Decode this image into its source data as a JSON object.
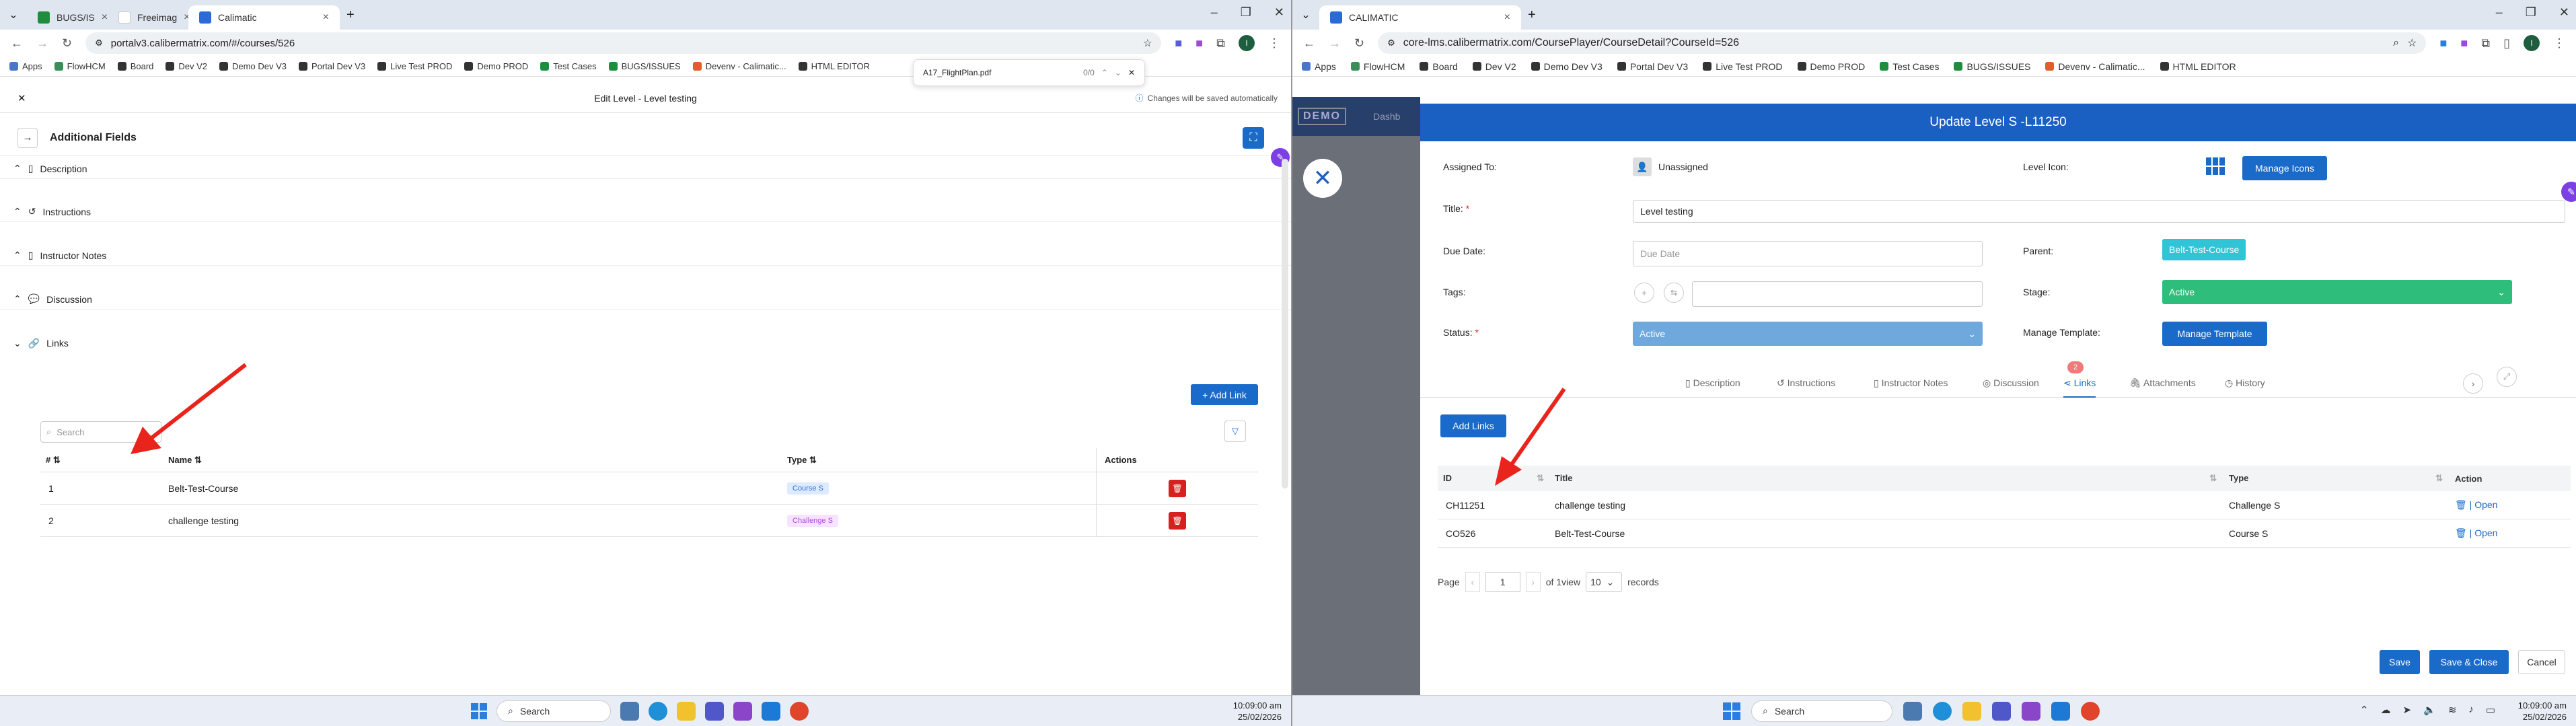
{
  "left": {
    "tabs": [
      {
        "label": "BUGS/IS",
        "color": "#1e8e3e"
      },
      {
        "label": "Freeimag",
        "color": "#ffffff"
      },
      {
        "label": "Calimatic",
        "color": "#2b6bd6"
      }
    ],
    "url": "portalv3.calibermatrix.com/#/courses/526",
    "bookmarks": [
      "Apps",
      "FlowHCM",
      "Board",
      "Dev V2",
      "Demo Dev V3",
      "Portal Dev V3",
      "Live Test PROD",
      "Demo PROD",
      "Test Cases",
      "BUGS/ISSUES",
      "Devenv - Calimatic...",
      "HTML EDITOR"
    ],
    "pdf_popup": {
      "name": "A17_FlightPlan.pdf",
      "pages": "0/0"
    },
    "header_title": "Edit Level - Level testing",
    "autosave": "Changes will be saved automatically",
    "panel_title": "Additional Fields",
    "sections": [
      "Description",
      "Instructions",
      "Instructor Notes",
      "Discussion",
      "Links"
    ],
    "add_link": "+ Add Link",
    "search_placeholder": "Search",
    "columns": [
      "#",
      "Name",
      "Type",
      "Actions"
    ],
    "rows": [
      {
        "num": "1",
        "name": "Belt-Test-Course",
        "type": "Course S",
        "type_color": "#dcebff",
        "type_text": "#3b6fd1"
      },
      {
        "num": "2",
        "name": "challenge testing",
        "type": "Challenge S",
        "type_color": "#f7e2ff",
        "type_text": "#b04bd6"
      }
    ],
    "taskbar_search": "Search",
    "clock_time": "10:09:00 am",
    "clock_date": "25/02/2026"
  },
  "right": {
    "tab": "CALIMATIC",
    "url": "core-lms.calibermatrix.com/CoursePlayer/CourseDetail?CourseId=526",
    "bookmarks": [
      "Apps",
      "FlowHCM",
      "Board",
      "Dev V2",
      "Demo Dev V3",
      "Portal Dev V3",
      "Live Test PROD",
      "Demo PROD",
      "Test Cases",
      "BUGS/ISSUES",
      "Devenv - Calimatic...",
      "HTML EDITOR"
    ],
    "bg_logo": "DEMO",
    "bg_nav": "Dashb",
    "modal_title": "Update Level S -L11250",
    "fields": {
      "assigned_label": "Assigned To:",
      "assigned_value": "Unassigned",
      "level_icon_label": "Level Icon:",
      "manage_icons": "Manage Icons",
      "title_label": "Title:",
      "title_value": "Level testing",
      "due_label": "Due Date:",
      "due_placeholder": "Due Date",
      "parent_label": "Parent:",
      "parent_value": "Belt-Test-Course",
      "tags_label": "Tags:",
      "stage_label": "Stage:",
      "stage_value": "Active",
      "status_label": "Status:",
      "status_value": "Active",
      "manage_template_label": "Manage Template:",
      "manage_template_btn": "Manage Template"
    },
    "tabs": [
      "Description",
      "Instructions",
      "Instructor Notes",
      "Discussion",
      "Links",
      "Attachments",
      "History"
    ],
    "links_badge": "2",
    "add_links": "Add Links",
    "columns": [
      "ID",
      "Title",
      "Type",
      "Action"
    ],
    "rows": [
      {
        "id": "CH11251",
        "title": "challenge testing",
        "type": "Challenge S",
        "action": "Open"
      },
      {
        "id": "CO526",
        "title": "Belt-Test-Course",
        "type": "Course S",
        "action": "Open"
      }
    ],
    "pager": {
      "page_label": "Page",
      "page": "1",
      "of": "of 1view",
      "size": "10",
      "records": "records"
    },
    "save": "Save",
    "save_close": "Save & Close",
    "cancel": "Cancel",
    "taskbar_search": "Search",
    "clock_time": "10:09:00 am",
    "clock_date": "25/02/2026"
  },
  "colors": {
    "accent": "#1a6ac9",
    "annotation_arrow": "#e8241c",
    "stage_green": "#2ebd7a",
    "status_blue": "#6fa8dc",
    "parent_teal": "#31c4d6",
    "modal_header": "#1a5fc2"
  }
}
